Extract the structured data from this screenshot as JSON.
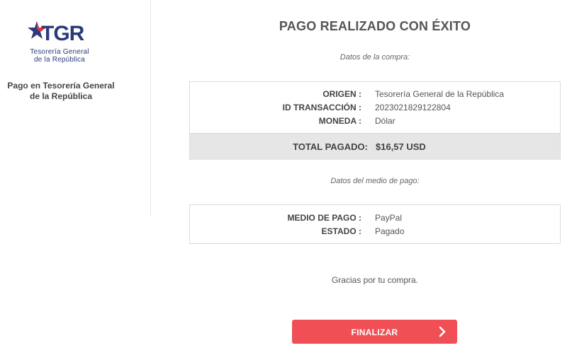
{
  "sidebar": {
    "logo_text": "TGR",
    "logo_subtitle_line1": "Tesorería General",
    "logo_subtitle_line2": "de la República",
    "title_line1": "Pago en Tesorería General",
    "title_line2": "de la República"
  },
  "main": {
    "title": "PAGO REALIZADO CON ÉXITO",
    "purchase_label": "Datos de la compra:",
    "purchase": {
      "rows": [
        {
          "key": "ORIGEN :",
          "value": "Tesorería General de la República"
        },
        {
          "key": "ID TRANSACCIÓN :",
          "value": "2023021829122804"
        },
        {
          "key": "MONEDA :",
          "value": "Dólar"
        }
      ],
      "total_key": "TOTAL PAGADO:",
      "total_value": "$16,57 USD"
    },
    "payment_label": "Datos del medio de pago:",
    "payment": {
      "rows": [
        {
          "key": "MEDIO DE PAGO :",
          "value": "PayPal"
        },
        {
          "key": "ESTADO :",
          "value": "Pagado"
        }
      ]
    },
    "thanks": "Gracias por tu compra.",
    "finish_button": "FINALIZAR"
  },
  "colors": {
    "brand_blue": "#2b3a7a",
    "brand_red": "#e5343c",
    "button_red": "#f05055",
    "total_band": "#e6e6e6"
  },
  "icons": {
    "logo_star": "star-icon",
    "button": "chevron-right-icon"
  }
}
